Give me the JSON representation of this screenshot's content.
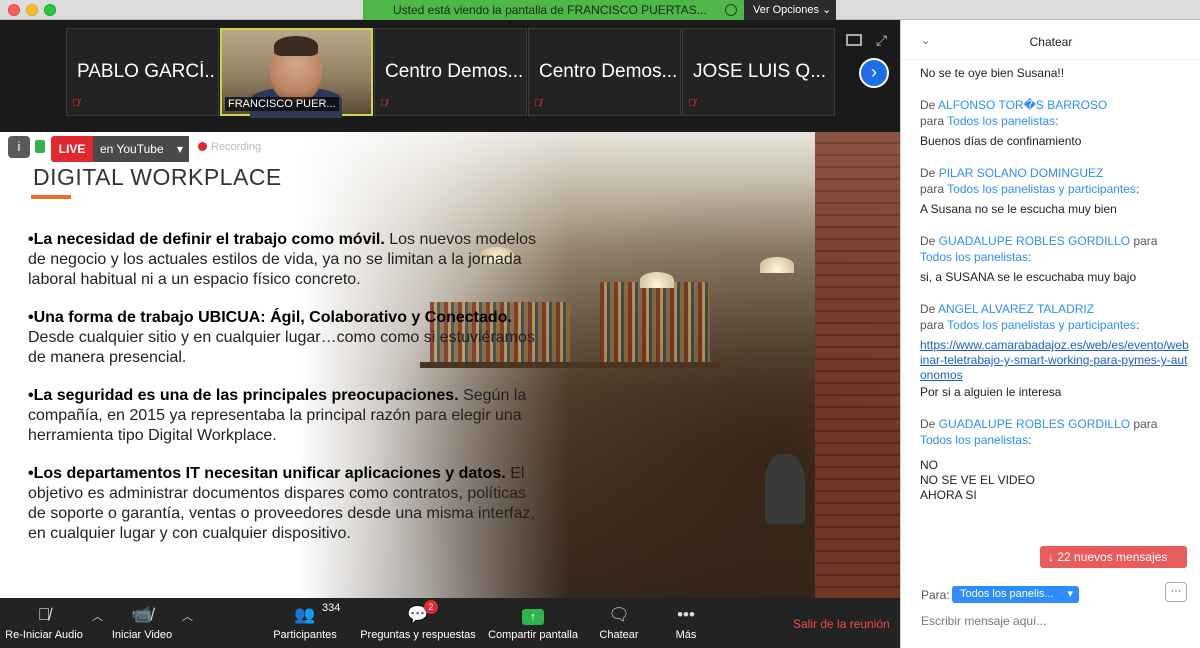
{
  "titlebar": {
    "banner": "Usted está viendo la pantalla de FRANCISCO PUERTAS...",
    "view_options": "Ver Opciones ⌄"
  },
  "participants_strip": [
    {
      "name": "PABLO GARCÍ...",
      "video": false
    },
    {
      "name": "FRANCISCO PUER...",
      "video": true
    },
    {
      "name": "Centro Demos...",
      "video": false
    },
    {
      "name": "Centro Demos...",
      "video": false
    },
    {
      "name": "JOSE LUIS Q...",
      "video": false
    }
  ],
  "live": {
    "badge": "LIVE",
    "destination": "en YouTube",
    "recording": "Recording"
  },
  "slide": {
    "title": "DIGITAL WORKPLACE",
    "bullets": [
      {
        "bold": "•La necesidad de definir el trabajo como móvil.",
        "rest": " Los nuevos modelos de negocio y los actuales estilos de vida, ya no se limitan a la jornada laboral habitual ni a un espacio físico concreto."
      },
      {
        "bold": "•Una forma de trabajo UBICUA: Ágil, Colaborativo y Conectado.",
        "rest": " Desde cualquier sitio y en cualquier lugar…como como si estuviéramos de manera presencial."
      },
      {
        "bold": "•La seguridad es una de las principales preocupaciones.",
        "rest": " Según la compañía, en 2015 ya representaba la principal razón para elegir una herramienta tipo Digital Workplace."
      },
      {
        "bold": "•Los departamentos IT necesitan unificar aplicaciones y datos.",
        "rest": " El objetivo es administrar documentos dispares como contratos, políticas de soporte o garantía, ventas o proveedores desde una misma interfaz, en cualquier lugar y con cualquier dispositivo."
      }
    ]
  },
  "toolbar": {
    "audio": "Re-Iniciar Audio",
    "video": "Iniciar Video",
    "participants": "Participantes",
    "participants_count": "334",
    "qa": "Preguntas y respuestas",
    "qa_badge": "2",
    "share": "Compartir pantalla",
    "chat": "Chatear",
    "more": "Más",
    "leave": "Salir de la reunión"
  },
  "chat": {
    "title": "Chatear",
    "first_message": "No se te oye bien Susana!!",
    "messages": [
      {
        "from_prefix": "De",
        "from": "ALFONSO TOR�S BARROSO",
        "to_prefix": "para",
        "to": "Todos los panelistas",
        "text": "Buenos días de confinamiento"
      },
      {
        "from_prefix": "De",
        "from": "PILAR SOLANO DOMINGUEZ",
        "to_prefix": "para",
        "to": "Todos los panelistas y participantes",
        "text": "A Susana no se le escucha muy bien"
      },
      {
        "from_prefix": "De",
        "from": "GUADALUPE ROBLES GORDILLO",
        "to_prefix": "para",
        "to": "Todos los panelistas",
        "text": "si, a SUSANA se le escuchaba muy bajo"
      },
      {
        "from_prefix": "De",
        "from": "ANGEL ALVAREZ TALADRIZ",
        "to_prefix": "para",
        "to": "Todos los panelistas y participantes",
        "link": "https://www.camarabadajoz.es/web/es/evento/webinar-teletrabajo-y-smart-working-para-pymes-y-autonomos",
        "text": "Por si a alguien le interesa"
      },
      {
        "from_prefix": "De",
        "from": "GUADALUPE ROBLES GORDILLO",
        "to_prefix": "para",
        "to": "Todos los panelistas",
        "text_lines": [
          "NO",
          "NO SE VE EL VIDEO",
          "AHORA SI"
        ]
      }
    ],
    "new_messages": "↓ 22 nuevos mensajes",
    "to_label": "Para:",
    "to_value": "Todos los panelis...",
    "more": "···",
    "input_placeholder": "Escribir mensaje aquí..."
  }
}
